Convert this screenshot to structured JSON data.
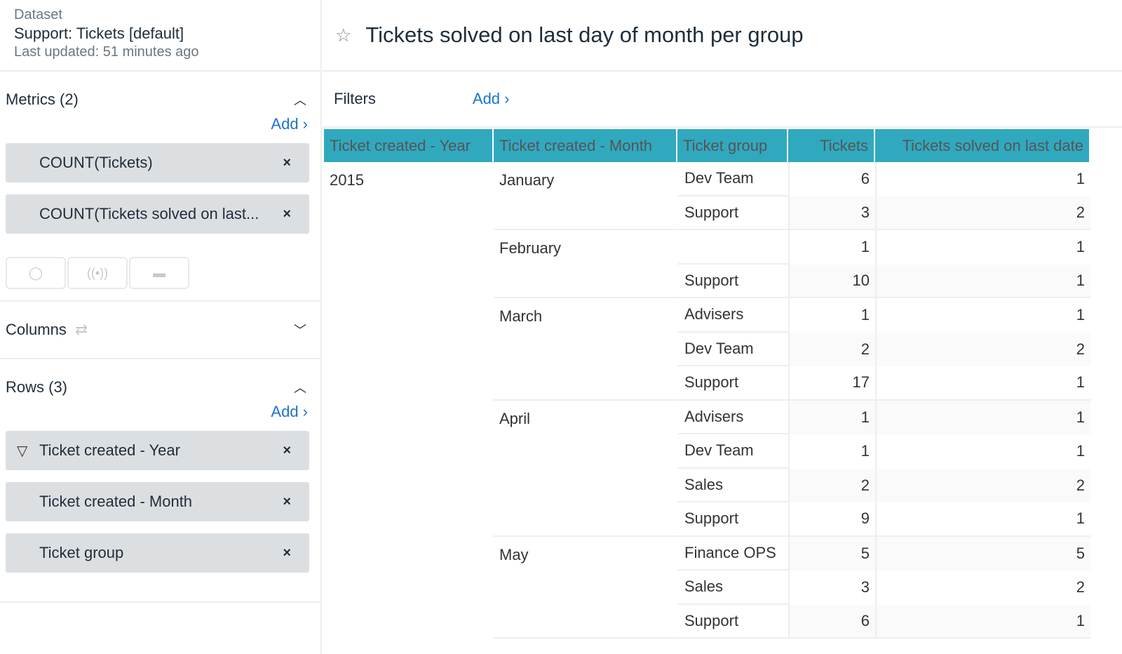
{
  "dataset": {
    "label": "Dataset",
    "name": "Support: Tickets [default]",
    "updated": "Last updated: 51 minutes ago"
  },
  "metrics": {
    "title": "Metrics (2)",
    "add": "Add ›",
    "items": [
      "COUNT(Tickets)",
      "COUNT(Tickets solved on last..."
    ],
    "tools": [
      "drop-icon",
      "broadcast-icon",
      "comment-icon"
    ]
  },
  "columns": {
    "title": "Columns"
  },
  "rows": {
    "title": "Rows (3)",
    "add": "Add ›",
    "items": [
      "Ticket created - Year",
      "Ticket created - Month",
      "Ticket group"
    ]
  },
  "report": {
    "title": "Tickets solved on last day of month per group"
  },
  "filters": {
    "label": "Filters",
    "add": "Add ›"
  },
  "colors": {
    "header": "#30a9bf",
    "link": "#1a73c9"
  },
  "table": {
    "headers": [
      "Ticket created - Year",
      "Ticket created - Month",
      "Ticket group",
      "Tickets",
      "Tickets solved on last date"
    ],
    "years": [
      {
        "year": "2015",
        "months": [
          {
            "month": "January",
            "rows": [
              [
                "Dev Team",
                "6",
                "1"
              ],
              [
                "Support",
                "3",
                "2"
              ]
            ]
          },
          {
            "month": "February",
            "rows": [
              [
                "",
                "1",
                "1"
              ],
              [
                "Support",
                "10",
                "1"
              ]
            ]
          },
          {
            "month": "March",
            "rows": [
              [
                "Advisers",
                "1",
                "1"
              ],
              [
                "Dev Team",
                "2",
                "2"
              ],
              [
                "Support",
                "17",
                "1"
              ]
            ]
          },
          {
            "month": "April",
            "rows": [
              [
                "Advisers",
                "1",
                "1"
              ],
              [
                "Dev Team",
                "1",
                "1"
              ],
              [
                "Sales",
                "2",
                "2"
              ],
              [
                "Support",
                "9",
                "1"
              ]
            ]
          },
          {
            "month": "May",
            "rows": [
              [
                "Finance OPS",
                "5",
                "5"
              ],
              [
                "Sales",
                "3",
                "2"
              ],
              [
                "Support",
                "6",
                "1"
              ]
            ]
          }
        ]
      }
    ]
  }
}
